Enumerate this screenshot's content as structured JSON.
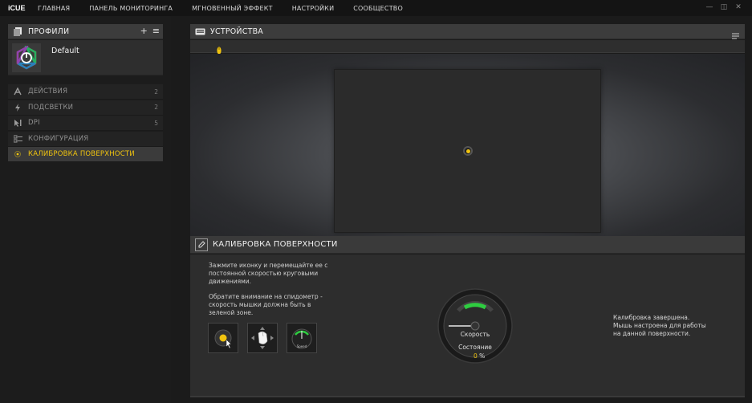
{
  "app": {
    "logo": "iCUE"
  },
  "nav": [
    "ГЛАВНАЯ",
    "ПАНЕЛЬ МОНИТОРИНГА",
    "МГНОВЕННЫЙ ЭФФЕКТ",
    "НАСТРОЙКИ",
    "СООБЩЕСТВО"
  ],
  "window_controls": {
    "minimize": "—",
    "restore": "◫",
    "close": "✕"
  },
  "profiles": {
    "title": "ПРОФИЛИ",
    "add": "+",
    "menu": "≡",
    "current": "Default"
  },
  "menu": [
    {
      "label": "ДЕЙСТВИЯ",
      "count": "2",
      "icon": "actions-icon"
    },
    {
      "label": "ПОДСВЕТКИ",
      "count": "2",
      "icon": "lighting-icon"
    },
    {
      "label": "DPI",
      "count": "5",
      "icon": "dpi-icon"
    },
    {
      "label": "КОНФИГУРАЦИЯ",
      "count": "",
      "icon": "config-icon"
    },
    {
      "label": "КАЛИБРОВКА ПОВЕРХНОСТИ",
      "count": "",
      "icon": "surface-icon",
      "active": true
    }
  ],
  "devices": {
    "title": "УСТРОЙСТВА"
  },
  "calibration": {
    "title": "КАЛИБРОВКА ПОВЕРХНОСТИ",
    "instr1": [
      "Зажмите иконку и перемещайте ее с",
      "постоянной скоростью круговыми",
      "движениями."
    ],
    "instr2": [
      "Обратите внимание на спидометр -",
      "скорость мышки должна быть в",
      "зеленой зоне."
    ],
    "tool3_label": "Speed",
    "speed_label": "Скорость",
    "state_label": "Состояние",
    "state_value": "0",
    "state_unit": "%",
    "result": [
      "Калибровка завершена.",
      "Мышь настроена для работы",
      "на данной поверхности."
    ]
  },
  "colors": {
    "accent": "#f1c40f",
    "gauge_green": "#2ecc40"
  }
}
